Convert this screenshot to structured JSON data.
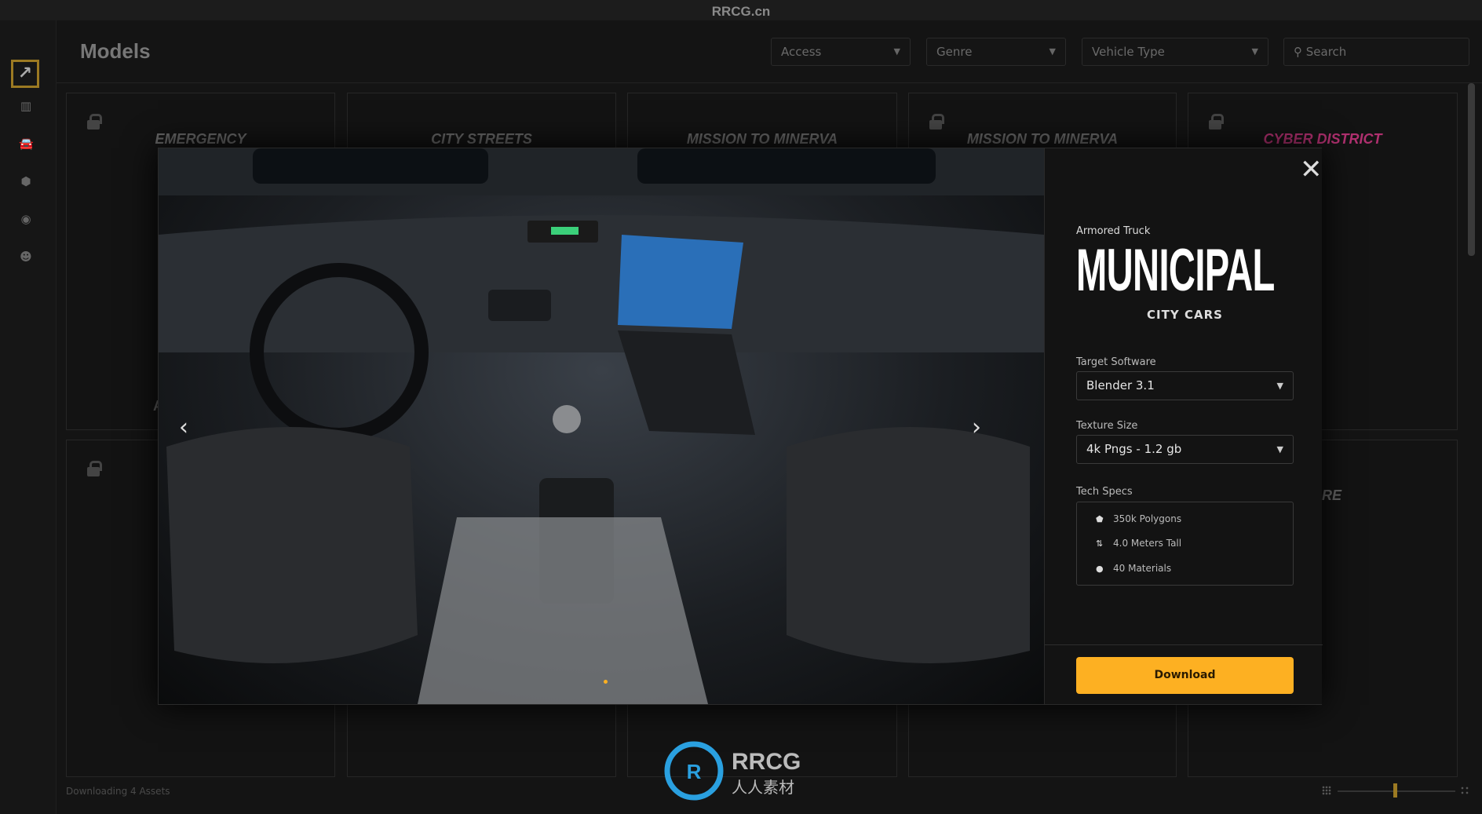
{
  "topbar": {
    "title": "RRCG.cn"
  },
  "sidebar": {
    "logo_icon": "arrow-up-right-icon",
    "items": [
      {
        "icon": "library-icon",
        "active": false
      },
      {
        "icon": "car-icon",
        "active": true
      },
      {
        "icon": "cube-icon",
        "active": false
      },
      {
        "icon": "disc-icon",
        "active": false
      },
      {
        "icon": "user-icon",
        "active": false
      }
    ]
  },
  "header": {
    "title": "Models",
    "filters": [
      {
        "label": "Access"
      },
      {
        "label": "Genre"
      },
      {
        "label": "Vehicle Type"
      }
    ],
    "search": {
      "placeholder": "Search"
    }
  },
  "grid": {
    "cards": [
      {
        "logo": "EMERGENCY",
        "locked": true,
        "label": "A"
      },
      {
        "logo": "CITY STREETS",
        "locked": false
      },
      {
        "logo": "MISSION TO MINERVA",
        "locked": false
      },
      {
        "logo": "MISSION TO MINERVA",
        "locked": true
      },
      {
        "logo": "CYBER DISTRICT",
        "locked": true
      },
      {
        "logo": "",
        "locked": true
      },
      {
        "logo": "",
        "locked": false
      },
      {
        "logo": "",
        "locked": false
      },
      {
        "logo": "",
        "locked": false
      },
      {
        "logo": "FARE",
        "locked": false
      }
    ]
  },
  "footer": {
    "status": "Downloading 4 Assets",
    "zoom_level": 0.5
  },
  "modal": {
    "category": "Armored Truck",
    "title": "MUNICIPAL",
    "collection": "CITY CARS",
    "target_software": {
      "label": "Target Software",
      "value": "Blender 3.1"
    },
    "texture_size": {
      "label": "Texture Size",
      "value": "4k Pngs - 1.2 gb"
    },
    "tech_specs": {
      "label": "Tech Specs",
      "items": [
        {
          "icon": "polygon-icon",
          "text": "350k Polygons"
        },
        {
          "icon": "height-icon",
          "text": "4.0 Meters Tall"
        },
        {
          "icon": "material-icon",
          "text": "40 Materials"
        }
      ]
    },
    "download_label": "Download",
    "accent": "#fdb022"
  },
  "watermark": {
    "text": "RRCG",
    "subtext": "人人素材"
  }
}
